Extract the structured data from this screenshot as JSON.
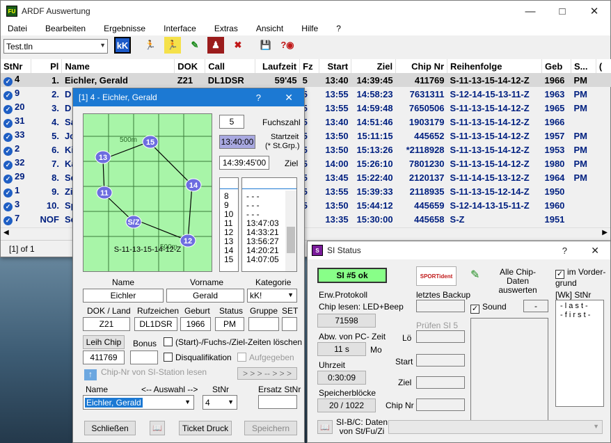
{
  "main": {
    "title": "ARDF Auswertung",
    "menu": [
      "Datei",
      "Bearbeiten",
      "Ergebnisse",
      "Interface",
      "Extras",
      "Ansicht",
      "Hilfe",
      "?"
    ],
    "file_combo": "Test.tln",
    "columns": [
      "StNr",
      "Pl",
      "Name",
      "DOK",
      "Call",
      "Laufzeit",
      "Fz",
      "Start",
      "Ziel",
      "Chip Nr",
      "Reihenfolge",
      "Geb",
      "S...",
      "("
    ],
    "rows": [
      [
        "4",
        "1.",
        "Eichler, Gerald",
        "Z21",
        "DL1DSR",
        "59'45",
        "5",
        "13:40",
        "14:39:45",
        "411769",
        "S-11-13-15-14-12-Z",
        "1966",
        "PM"
      ],
      [
        "9",
        "2.",
        "D",
        "",
        "",
        "",
        "5",
        "13:55",
        "14:58:23",
        "7631311",
        "S-12-14-15-13-11-Z",
        "1963",
        "PM"
      ],
      [
        "20",
        "3.",
        "D",
        "",
        "",
        "",
        "5",
        "13:55",
        "14:59:48",
        "7650506",
        "S-11-13-15-14-12-Z",
        "1965",
        "PM"
      ],
      [
        "31",
        "4.",
        "Sa",
        "",
        "",
        "",
        "5",
        "13:40",
        "14:51:46",
        "1903179",
        "S-11-13-15-14-12-Z",
        "1966",
        ""
      ],
      [
        "33",
        "5.",
        "Jo",
        "",
        "",
        "",
        "5",
        "13:50",
        "15:11:15",
        "445652",
        "S-11-13-15-14-12-Z",
        "1957",
        "PM"
      ],
      [
        "2",
        "6.",
        "Ki",
        "",
        "",
        "",
        "5",
        "13:50",
        "15:13:26",
        "*2118928",
        "S-11-13-15-14-12-Z",
        "1953",
        "PM"
      ],
      [
        "32",
        "7.",
        "Ka",
        "",
        "",
        "",
        "5",
        "14:00",
        "15:26:10",
        "7801230",
        "S-11-13-15-14-12-Z",
        "1980",
        "PM"
      ],
      [
        "29",
        "8.",
        "Se",
        "",
        "",
        "",
        "5",
        "13:45",
        "15:22:40",
        "2120137",
        "S-11-14-15-13-12-Z",
        "1964",
        "PM"
      ],
      [
        "1",
        "9.",
        "Zi",
        "",
        "",
        "",
        "5",
        "13:55",
        "15:39:33",
        "2118935",
        "S-11-13-15-12-14-Z",
        "1950",
        ""
      ],
      [
        "3",
        "10.",
        "Sp",
        "",
        "",
        "",
        "5",
        "13:50",
        "15:44:12",
        "445659",
        "S-12-14-13-15-11-Z",
        "1960",
        ""
      ],
      [
        "7",
        "NOF",
        "Se",
        "",
        "",
        "",
        "",
        "13:35",
        "15:30:00",
        "445658",
        "S-Z",
        "1951",
        ""
      ]
    ],
    "status": "[1] of 1"
  },
  "detail": {
    "title": "[1] 4 - Eichler, Gerald",
    "help": "?",
    "close": "✕",
    "map": {
      "scale_a": "500m",
      "scale_b": "500m",
      "route": "S-11-13-15-14-12-Z",
      "nodes": [
        "15",
        "13",
        "14",
        "11",
        "S/Z",
        "12"
      ]
    },
    "fuchszahl_value": "5",
    "fuchszahl_label": "Fuchszahl",
    "startzeit_value": "13:40:00",
    "startzeit_label": "Startzeit",
    "startzeit_sub": "(* St.Grp.)",
    "ziel_value": "14:39:45'00",
    "ziel_label": "Ziel",
    "list_nums": [
      "8",
      "9",
      "10",
      "11",
      "12",
      "13",
      "14",
      "15"
    ],
    "list_times": [
      "- - -",
      "- - -",
      "- - -",
      "13:47:03",
      "14:33:21",
      "13:56:27",
      "14:20:21",
      "14:07:05"
    ],
    "name_label": "Name",
    "name_value": "Eichler",
    "vorname_label": "Vorname",
    "vorname_value": "Gerald",
    "kategorie_label": "Kategorie",
    "kategorie_value": "kK!",
    "dok_label": "DOK / Land",
    "dok_value": "Z21",
    "call_label": "Rufzeichen",
    "call_value": "DL1DSR",
    "geb_label": "Geburt",
    "geb_value": "1966",
    "status_label": "Status",
    "status_value": "PM",
    "gruppe_label": "Gruppe",
    "set_label": "SET",
    "leih_label": "Leih Chip",
    "chip_value": "411769",
    "bonus_label": "Bonus",
    "clear_label": "(Start)-/Fuchs-/Ziel-Zeiten löschen",
    "disq_label": "Disqualifikation",
    "aufg_label": "Aufgegeben",
    "chipread_label": "Chip-Nr von SI-Station lesen",
    "arrows_label": "> > > -- > > >",
    "sel_name_label": "Name",
    "auswahl_label": "<-- Auswahl -->",
    "stnr_label": "StNr",
    "ersatz_label": "Ersatz StNr",
    "sel_name_value": "Eichler, Gerald",
    "stnr_value": "4",
    "schliessen": "Schließen",
    "ticket": "Ticket Druck",
    "speichern": "Speichern"
  },
  "si": {
    "title": "SI Status",
    "help": "?",
    "close": "✕",
    "station": "SI #5 ok",
    "logo": "SPORTident",
    "alle_label": "Alle Chip-Daten auswerten",
    "vorder_label": "im Vorder-grund",
    "erw_label": "Erw.Protokoll",
    "backup_label": "letztes Backup",
    "chip_lesen_label": "Chip lesen: LED+Beep",
    "sound_label": "Sound",
    "sound_value": "-",
    "wk_label": "[Wk] StNr",
    "wk_items": [
      "- l a s t -",
      "- f i r s t -"
    ],
    "chip_count": "71598",
    "pruefen_label": "Prüfen SI 5",
    "abw_label": "Abw. von PC- Zeit",
    "abw_value": "11 s",
    "mo_label": "Mo",
    "lo_label": "Lö",
    "start_label": "Start",
    "uhrzeit_label": "Uhrzeit",
    "uhrzeit_value": "0:30:09",
    "ziel_label": "Ziel",
    "speicher_label": "Speicherblöcke",
    "speicher_value": "20 / 1022",
    "chipnr_label": "Chip Nr",
    "sib_label": "SI-B/C: Daten von St/Fu/Zi"
  },
  "colors": {
    "accent": "#1c79d3",
    "map_bg": "#a8f5a8",
    "node": "#6d6de0",
    "selected_field": "#a8a8e0",
    "status_ok": "#88ff88"
  }
}
